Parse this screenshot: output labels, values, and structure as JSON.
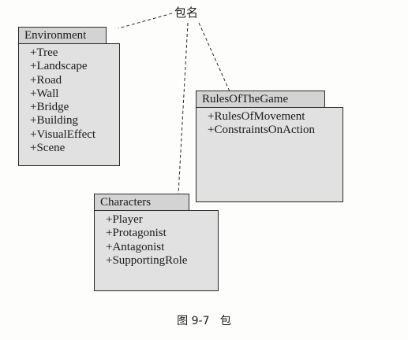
{
  "callout_label": "包名",
  "packages": [
    {
      "name": "Environment",
      "items": [
        "+Tree",
        "+Landscape",
        "+Road",
        "+Wall",
        "+Bridge",
        "+Building",
        "+VisualEffect",
        "+Scene"
      ]
    },
    {
      "name": "RulesOfTheGame",
      "items": [
        "+RulesOfMovement",
        "+ConstraintsOnAction"
      ]
    },
    {
      "name": "Characters",
      "items": [
        "+Player",
        "+Protagonist",
        "+Antagonist",
        "+SupportingRole"
      ]
    }
  ],
  "caption": "图 9-7   包"
}
